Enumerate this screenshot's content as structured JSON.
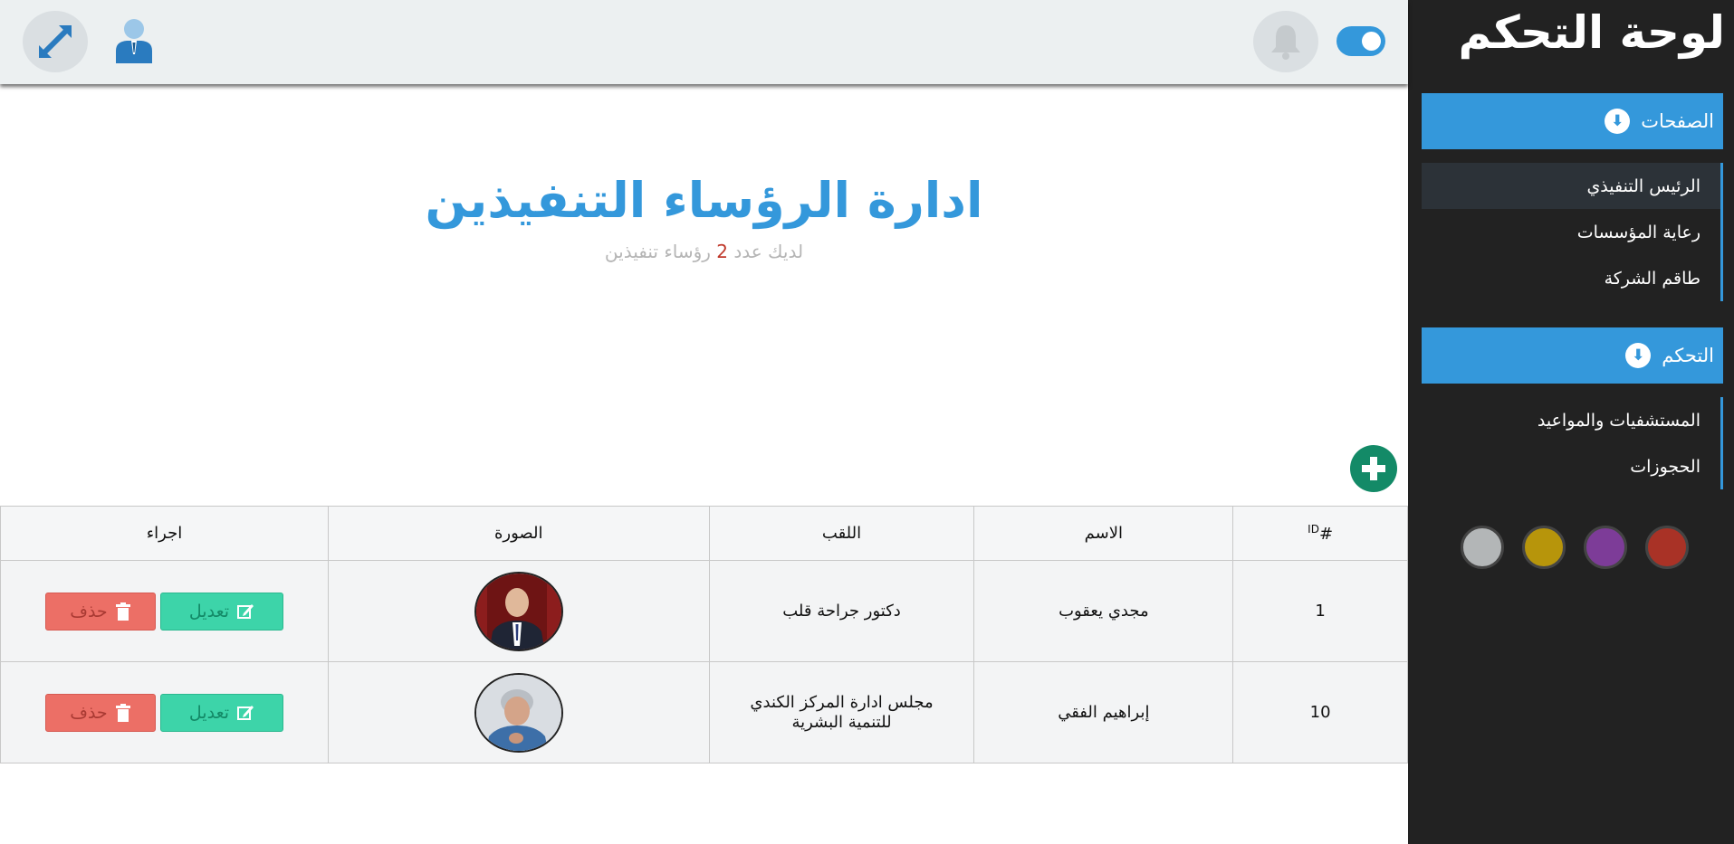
{
  "sidebar": {
    "brand": "لوحة التحكم",
    "sections": [
      {
        "title": "الصفحات",
        "items": [
          "الرئيس التنفيذي",
          "رعاية المؤسسات",
          "طاقم الشركة"
        ]
      },
      {
        "title": "التحكم",
        "items": [
          "المستشفيات والمواعيد",
          "الحجوزات"
        ]
      }
    ],
    "active_item": "الرئيس التنفيذي",
    "theme_colors": [
      "#a93226",
      "#7d3c98",
      "#b7950b",
      "#b3b6b7"
    ]
  },
  "topbar": {
    "icons": [
      "expand-icon",
      "user-icon",
      "bell-icon",
      "toggle-switch"
    ],
    "toggle_on": true
  },
  "main": {
    "title": "ادارة الرؤساء التنفيذين",
    "subtitle_prefix": "لديك عدد",
    "subtitle_count": "2",
    "subtitle_suffix": "رؤساء تنفيذين",
    "add_icon": "plus-icon"
  },
  "table": {
    "headers": {
      "id": "#",
      "id_sup": "ID",
      "name": "الاسم",
      "title": "اللقب",
      "photo": "الصورة",
      "actions": "اجراء"
    },
    "rows": [
      {
        "id": "1",
        "name": "مجدي يعقوب",
        "title": "دكتور جراحة قلب",
        "edit_label": "تعديل",
        "delete_label": "حذف"
      },
      {
        "id": "10",
        "name": "إبراهيم الفقي",
        "title": "مجلس ادارة المركز الكندي للتنمية البشرية",
        "edit_label": "تعديل",
        "delete_label": "حذف"
      }
    ]
  },
  "colors": {
    "accent": "#3498db",
    "sidebar_bg": "#222222",
    "edit": "#3dd4a9",
    "delete": "#ec6f66",
    "add": "#138a67"
  }
}
